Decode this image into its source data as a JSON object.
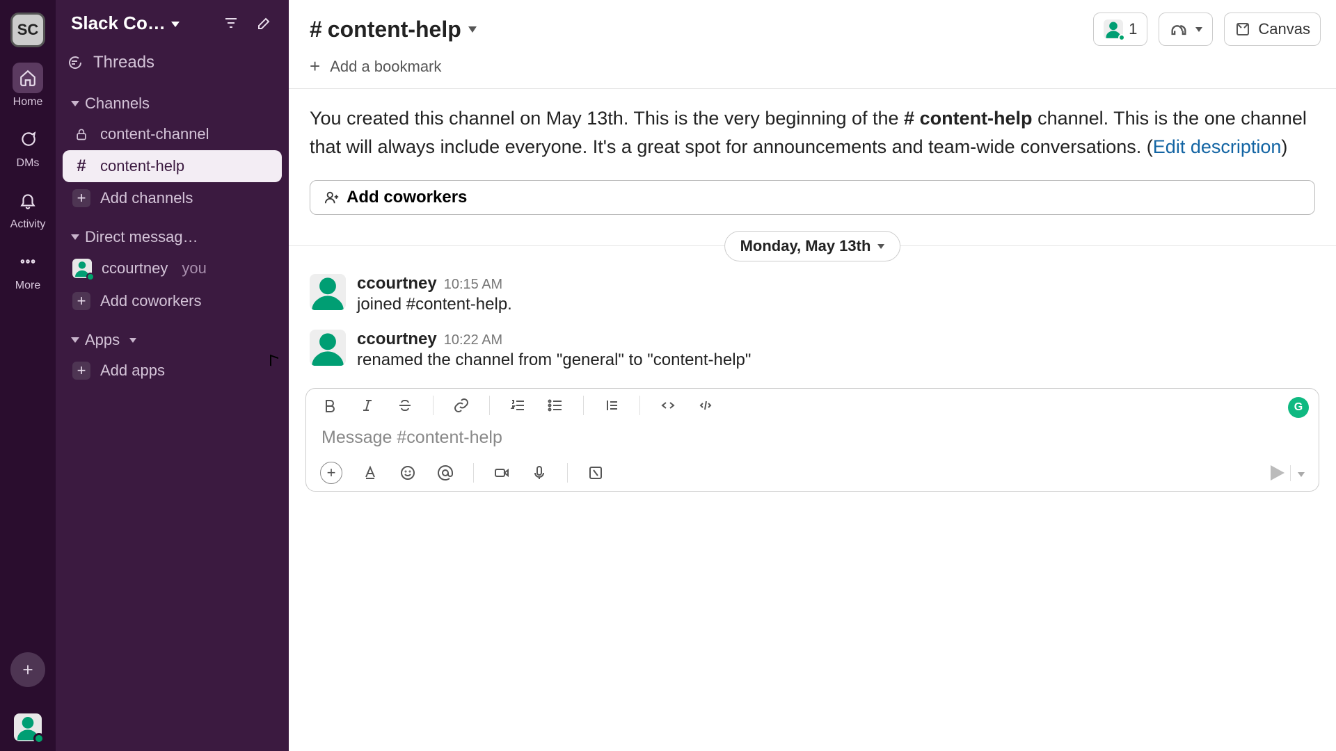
{
  "workspace": {
    "initials": "SC",
    "name": "Slack Co…"
  },
  "rail": {
    "home": "Home",
    "dms": "DMs",
    "activity": "Activity",
    "more": "More"
  },
  "sidebar": {
    "threads": "Threads",
    "channels_label": "Channels",
    "channels": [
      {
        "name": "content-channel",
        "locked": true
      },
      {
        "name": "content-help",
        "active": true
      }
    ],
    "add_channels": "Add channels",
    "dms_label": "Direct messag…",
    "dms": [
      {
        "name": "ccourtney",
        "you": "you"
      }
    ],
    "add_coworkers": "Add coworkers",
    "apps_label": "Apps",
    "add_apps": "Add apps"
  },
  "channel": {
    "name": "content-help",
    "members": "1",
    "canvas": "Canvas",
    "add_bookmark": "Add a bookmark",
    "intro_pre": "You created this channel on May 13th. This is the very beginning of the ",
    "intro_ref": "# content-help",
    "intro_post": " channel. This is the one channel that will always include everyone. It's a great spot for announcements and team-wide conversations. (",
    "edit_desc": "Edit description",
    "intro_close": ")",
    "add_coworkers_btn": "Add coworkers",
    "date": "Monday, May 13th"
  },
  "messages": [
    {
      "user": "ccourtney",
      "time": "10:15 AM",
      "text": "joined #content-help."
    },
    {
      "user": "ccourtney",
      "time": "10:22 AM",
      "text": "renamed the channel from \"general\" to \"content-help\""
    }
  ],
  "composer": {
    "placeholder": "Message #content-help"
  }
}
